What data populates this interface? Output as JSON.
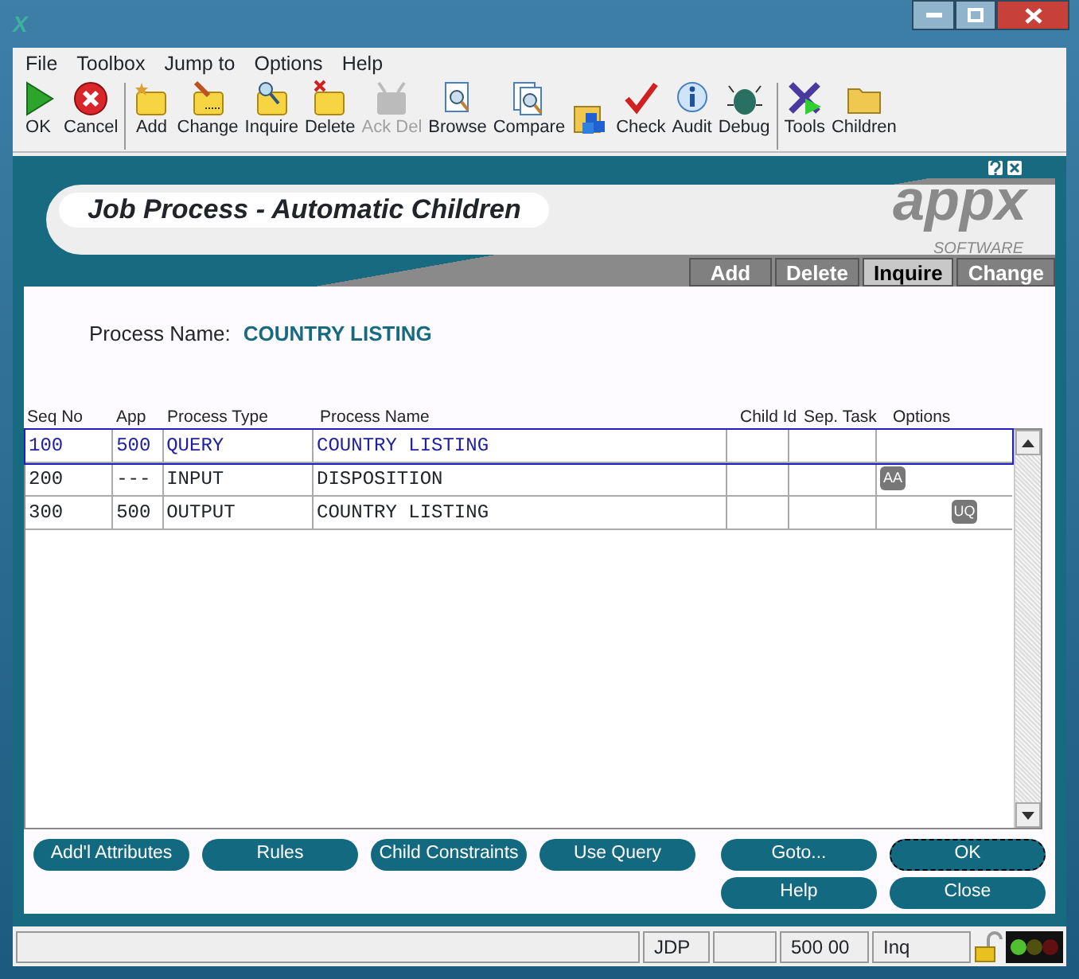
{
  "window": {
    "title_icon": "X"
  },
  "menu": [
    "File",
    "Toolbox",
    "Jump to",
    "Options",
    "Help"
  ],
  "toolbar_groups": [
    [
      {
        "label": "OK",
        "disabled": false
      },
      {
        "label": "Cancel",
        "disabled": false
      }
    ],
    [
      {
        "label": "Add",
        "disabled": false
      },
      {
        "label": "Change",
        "disabled": false
      },
      {
        "label": "Inquire",
        "disabled": false
      },
      {
        "label": "Delete",
        "disabled": false
      },
      {
        "label": "Ack Del",
        "disabled": true
      },
      {
        "label": "Browse",
        "disabled": false
      },
      {
        "label": "Compare",
        "disabled": false
      },
      {
        "disabled": false
      },
      {
        "label": "Check",
        "disabled": false
      },
      {
        "label": "Audit",
        "disabled": false
      },
      {
        "label": "Debug",
        "disabled": false
      }
    ],
    [
      {
        "label": "Tools",
        "disabled": false
      },
      {
        "label": "Children",
        "disabled": false
      }
    ]
  ],
  "header": {
    "title": "Job Process - Automatic Children",
    "logo": "appx",
    "logo_tagline": "SOFTWARE"
  },
  "action_tabs": [
    {
      "label": "Add",
      "selected": false
    },
    {
      "label": "Delete",
      "selected": false
    },
    {
      "label": "Inquire",
      "selected": true
    },
    {
      "label": "Change",
      "selected": false
    }
  ],
  "process_name": {
    "label": "Process Name:",
    "value": "COUNTRY LISTING"
  },
  "table": {
    "columns": [
      "Seq No",
      "App",
      "Process Type",
      "Process Name",
      "Child Id",
      "Sep. Task",
      "Options"
    ],
    "rows": [
      {
        "cells": [
          "100",
          "500",
          "QUERY",
          "COUNTRY LISTING"
        ],
        "selected": true,
        "options": []
      },
      {
        "cells": [
          "200",
          "---",
          "INPUT",
          "DISPOSITION"
        ],
        "selected": false,
        "options": [
          "AA"
        ]
      },
      {
        "cells": [
          "300",
          "500",
          "OUTPUT",
          "COUNTRY LISTING"
        ],
        "selected": false,
        "options_right": [
          "UQ"
        ]
      }
    ]
  },
  "buttons_left": [
    "Add'l Attributes",
    "Rules",
    "Child Constraints",
    "Use Query"
  ],
  "buttons_right": [
    {
      "label": "Goto...",
      "focused": false
    },
    {
      "label": "OK",
      "focused": true
    },
    {
      "label": "Help",
      "focused": false
    },
    {
      "label": "Close",
      "focused": false
    }
  ],
  "status_bar": [
    "JDP",
    "500 00",
    "Inq"
  ]
}
